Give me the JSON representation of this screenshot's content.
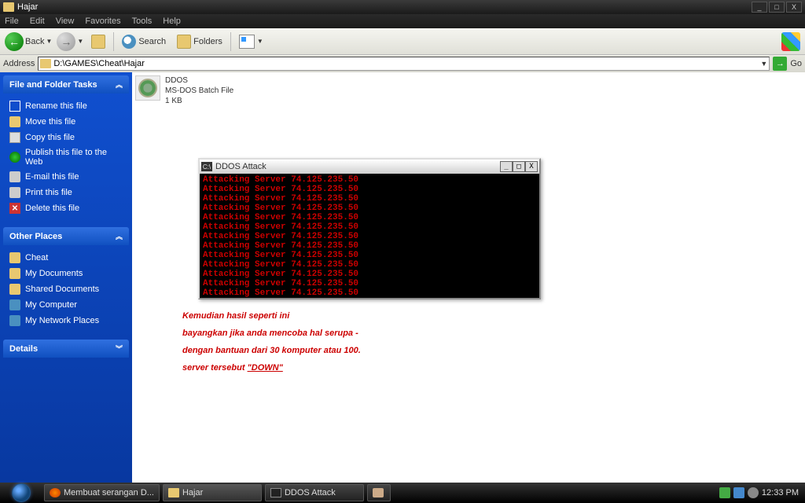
{
  "window": {
    "title": "Hajar",
    "buttons": {
      "min": "_",
      "max": "□",
      "close": "X"
    }
  },
  "menu": [
    "File",
    "Edit",
    "View",
    "Favorites",
    "Tools",
    "Help"
  ],
  "toolbar": {
    "back": "Back",
    "search": "Search",
    "folders": "Folders"
  },
  "address": {
    "label": "Address",
    "value": "D:\\GAMES\\Cheat\\Hajar",
    "go": "→",
    "go_label": "Go"
  },
  "sidebar": {
    "panels": [
      {
        "title": "File and Folder Tasks",
        "items": [
          {
            "icon": "ico-rename",
            "label": "Rename this file"
          },
          {
            "icon": "ico-move",
            "label": "Move this file"
          },
          {
            "icon": "ico-copy",
            "label": "Copy this file"
          },
          {
            "icon": "ico-publish",
            "label": "Publish this file to the Web"
          },
          {
            "icon": "ico-email",
            "label": "E-mail this file"
          },
          {
            "icon": "ico-print",
            "label": "Print this file"
          },
          {
            "icon": "ico-delete",
            "label": "Delete this file"
          }
        ]
      },
      {
        "title": "Other Places",
        "items": [
          {
            "icon": "ico-cheat",
            "label": "Cheat"
          },
          {
            "icon": "ico-docs",
            "label": "My Documents"
          },
          {
            "icon": "ico-shared",
            "label": "Shared Documents"
          },
          {
            "icon": "ico-comp",
            "label": "My Computer"
          },
          {
            "icon": "ico-net",
            "label": "My Network Places"
          }
        ]
      },
      {
        "title": "Details",
        "items": []
      }
    ]
  },
  "file": {
    "name": "DDOS",
    "type": "MS-DOS Batch File",
    "size": "1 KB"
  },
  "console": {
    "title": "DDOS Attack",
    "icon_text": "C:\\",
    "lines": [
      "Attacking Server 74.125.235.50",
      "Attacking Server 74.125.235.50",
      "Attacking Server 74.125.235.50",
      "Attacking Server 74.125.235.50",
      "Attacking Server 74.125.235.50",
      "Attacking Server 74.125.235.50",
      "Attacking Server 74.125.235.50",
      "Attacking Server 74.125.235.50",
      "Attacking Server 74.125.235.50",
      "Attacking Server 74.125.235.50",
      "Attacking Server 74.125.235.50",
      "Attacking Server 74.125.235.50",
      "Attacking Server 74.125.235.50"
    ]
  },
  "caption": {
    "l1": "Kemudian hasil seperti ini",
    "l2": "bayangkan jika anda mencoba hal serupa -",
    "l3": "dengan bantuan dari 30 komputer atau 100.",
    "l4a": "server tersebut ",
    "l4b": "\"DOWN\""
  },
  "taskbar": {
    "buttons": [
      {
        "icon": "fox",
        "label": "Membuat serangan D..."
      },
      {
        "icon": "fold",
        "label": "Hajar"
      },
      {
        "icon": "cmd",
        "label": "DDOS Attack"
      },
      {
        "icon": "hand",
        "label": ""
      }
    ],
    "clock": "12:33 PM"
  }
}
